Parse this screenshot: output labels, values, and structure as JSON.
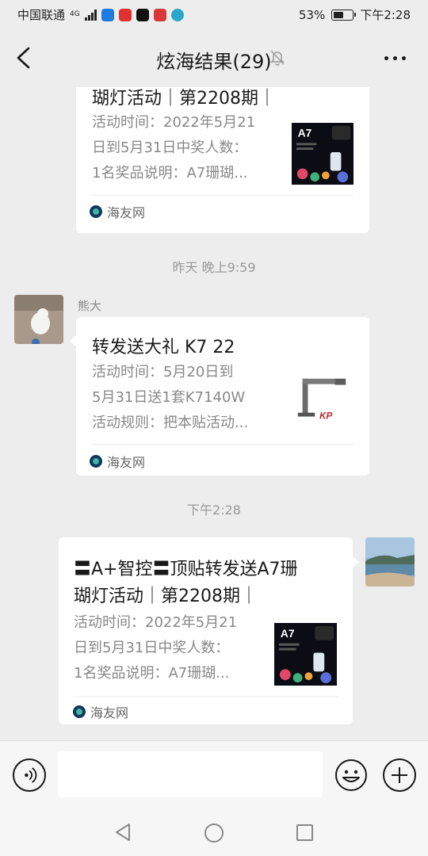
{
  "status_bar": {
    "carrier": "中国联通",
    "network": "4G",
    "battery": "53%",
    "time": "下午2:28"
  },
  "header": {
    "title": "炫海结果(29)",
    "icons": [
      "back-arrow",
      "mute-bell",
      "more-dots"
    ]
  },
  "messages": [
    {
      "type": "link-card",
      "title": "瑚灯活动｜第2208期｜",
      "desc_lines": [
        "活动时间：2022年5月21",
        "日到5月31日中奖人数：",
        "1名奖品说明：A7珊瑚..."
      ],
      "source": "海友网",
      "thumb_label": "A7"
    },
    {
      "type": "time",
      "text": "昨天 晚上9:59"
    },
    {
      "type": "link-card",
      "sender": "熊大",
      "title": "转发送大礼 K7 22",
      "desc_lines": [
        "活动时间：5月20日到",
        "5月31日送1套K7140W",
        "活动规则：把本贴活动..."
      ],
      "source": "海友网",
      "thumb_label": "K7"
    },
    {
      "type": "time",
      "text": "下午2:28"
    },
    {
      "type": "link-card",
      "self": true,
      "title_lines": [
        "〓A+智控〓顶贴转发送A7珊",
        "瑚灯活动｜第2208期｜"
      ],
      "desc_lines": [
        "活动时间：2022年5月21",
        "日到5月31日中奖人数：",
        "1名奖品说明：A7珊瑚..."
      ],
      "source": "海友网",
      "thumb_label": "A7"
    }
  ],
  "input_bar": {
    "placeholder": "",
    "icons": [
      "voice-icon",
      "emoji-icon",
      "plus-icon"
    ]
  },
  "colors": {
    "background": "#ededed",
    "card": "#ffffff",
    "text": "#191919",
    "muted": "#888888"
  }
}
